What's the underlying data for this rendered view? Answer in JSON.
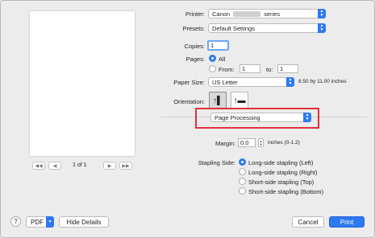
{
  "preview": {
    "page_indicator": "1 of 1"
  },
  "pager": {
    "first": "◀◀",
    "prev": "◀",
    "next": "▶",
    "last": "▶▶"
  },
  "printer": {
    "label": "Printer:",
    "value_prefix": "Canon",
    "value_suffix": "series"
  },
  "presets": {
    "label": "Presets:",
    "value": "Default Settings"
  },
  "copies": {
    "label": "Copies:",
    "value": "1"
  },
  "pages": {
    "label": "Pages:",
    "all_label": "All",
    "from_label": "From:",
    "from_value": "1",
    "to_label": "to:",
    "to_value": "1"
  },
  "paper_size": {
    "label": "Paper Size:",
    "value": "US Letter",
    "dimensions": "8.50 by 11.00 inches"
  },
  "orientation": {
    "label": "Orientation:",
    "portrait_glyph": "↑▌",
    "landscape_glyph": "↑▬"
  },
  "section_menu": {
    "value": "Page Processing"
  },
  "margin": {
    "label": "Margin:",
    "value": "0.0",
    "unit": "inches (0-1.2)"
  },
  "stapling": {
    "label": "Stapling Side:",
    "options": [
      "Long-side stapling (Left)",
      "Long-side stapling (Right)",
      "Short-side stapling (Top)",
      "Short-side stapling (Bottom)"
    ]
  },
  "footer": {
    "help": "?",
    "pdf": "PDF",
    "hide_details": "Hide Details",
    "cancel": "Cancel",
    "print": "Print"
  },
  "colors": {
    "accent": "#2d79f2",
    "highlight": "#e0313c"
  }
}
